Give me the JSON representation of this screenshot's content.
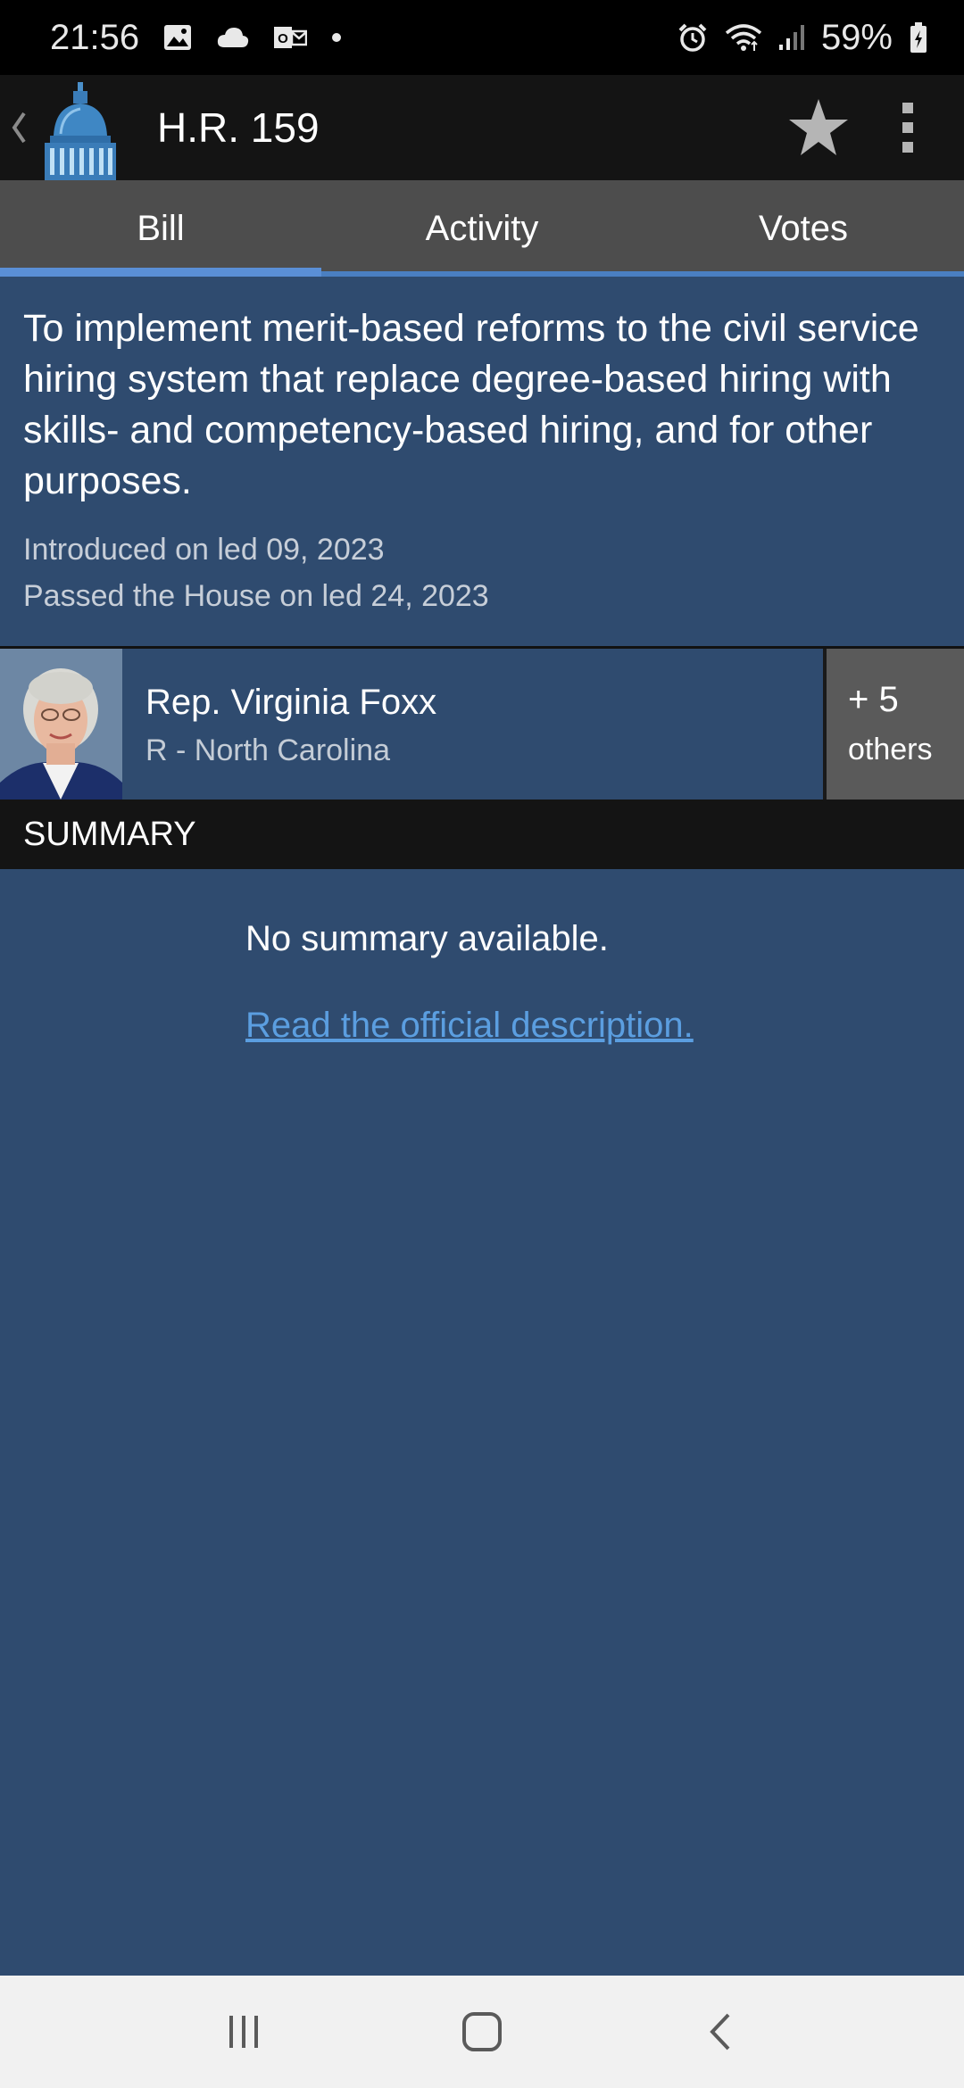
{
  "status_bar": {
    "time": "21:56",
    "battery": "59%",
    "left_icons": [
      "image-icon",
      "cloud-icon",
      "outlook-icon",
      "dot-icon"
    ],
    "right_icons": [
      "alarm-icon",
      "wifi-icon",
      "signal-icon",
      "battery-charging-icon"
    ]
  },
  "app_bar": {
    "title": "H.R. 159",
    "icons": [
      "back-chevron-icon",
      "capitol-logo-icon",
      "star-icon",
      "more-vert-icon"
    ]
  },
  "tabs": [
    {
      "label": "Bill",
      "active": true
    },
    {
      "label": "Activity",
      "active": false
    },
    {
      "label": "Votes",
      "active": false
    }
  ],
  "bill": {
    "title": "To implement merit-based reforms to the civil service hiring system that replace degree-based hiring with skills- and competency-based hiring, and for other purposes.",
    "introduced": "Introduced on led 09, 2023",
    "passed": "Passed the House on led 24, 2023"
  },
  "sponsor": {
    "name": "Rep. Virginia Foxx",
    "party_state": "R - North Carolina",
    "others_count": "+ 5",
    "others_label": "others"
  },
  "summary": {
    "header": "SUMMARY",
    "text": "No summary available.",
    "link": "Read the official description."
  },
  "nav_bar": {
    "icons": [
      "recents-icon",
      "home-icon",
      "back-icon"
    ]
  },
  "colors": {
    "background": "#2f4b6f",
    "app_bar": "#141414",
    "tabs": "#4d4d4d",
    "tab_indicator": "#5a8fd6",
    "link": "#5b9ee0",
    "others_button": "#5a5a5a"
  }
}
